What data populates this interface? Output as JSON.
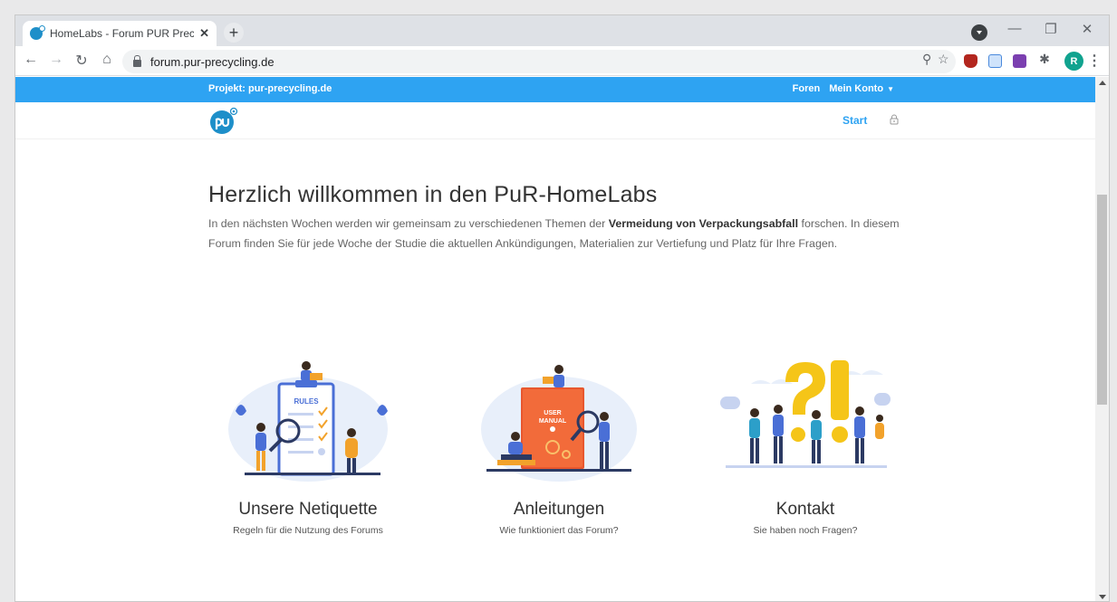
{
  "browser": {
    "tab_title": "HomeLabs - Forum PUR Precycli",
    "tab_close": "✕",
    "new_tab": "+",
    "url": "forum.pur-precycling.de",
    "avatar_initial": "R",
    "minimize": "—",
    "restore": "❐",
    "close": "✕"
  },
  "site": {
    "project_label": "Projekt: pur-precycling.de",
    "nav_forums": "Foren",
    "nav_account": "Mein Konto",
    "start_link": "Start",
    "accent_color": "#2ea3f2"
  },
  "welcome": {
    "title": "Herzlich willkommen in den PuR-HomeLabs",
    "text_before": "In den nächsten Wochen werden wir gemeinsam zu verschiedenen Themen der ",
    "text_bold": "Vermeidung von Verpackungsabfall",
    "text_after": " forschen. In diesem Forum finden Sie für jede Woche der Studie die aktuellen Ankündigungen, Materialien zur Vertiefung und Platz für Ihre Fragen."
  },
  "cards": [
    {
      "title": "Unsere Netiquette",
      "subtitle": "Regeln für die Nutzung des Forums",
      "board_label": "RULES",
      "icon": "rules-illustration"
    },
    {
      "title": "Anleitungen",
      "subtitle": "Wie funktioniert das Forum?",
      "book_label_1": "USER",
      "book_label_2": "MANUAL",
      "icon": "user-manual-illustration"
    },
    {
      "title": "Kontakt",
      "subtitle": "Sie haben noch Fragen?",
      "icon": "question-exclamation-illustration"
    }
  ]
}
